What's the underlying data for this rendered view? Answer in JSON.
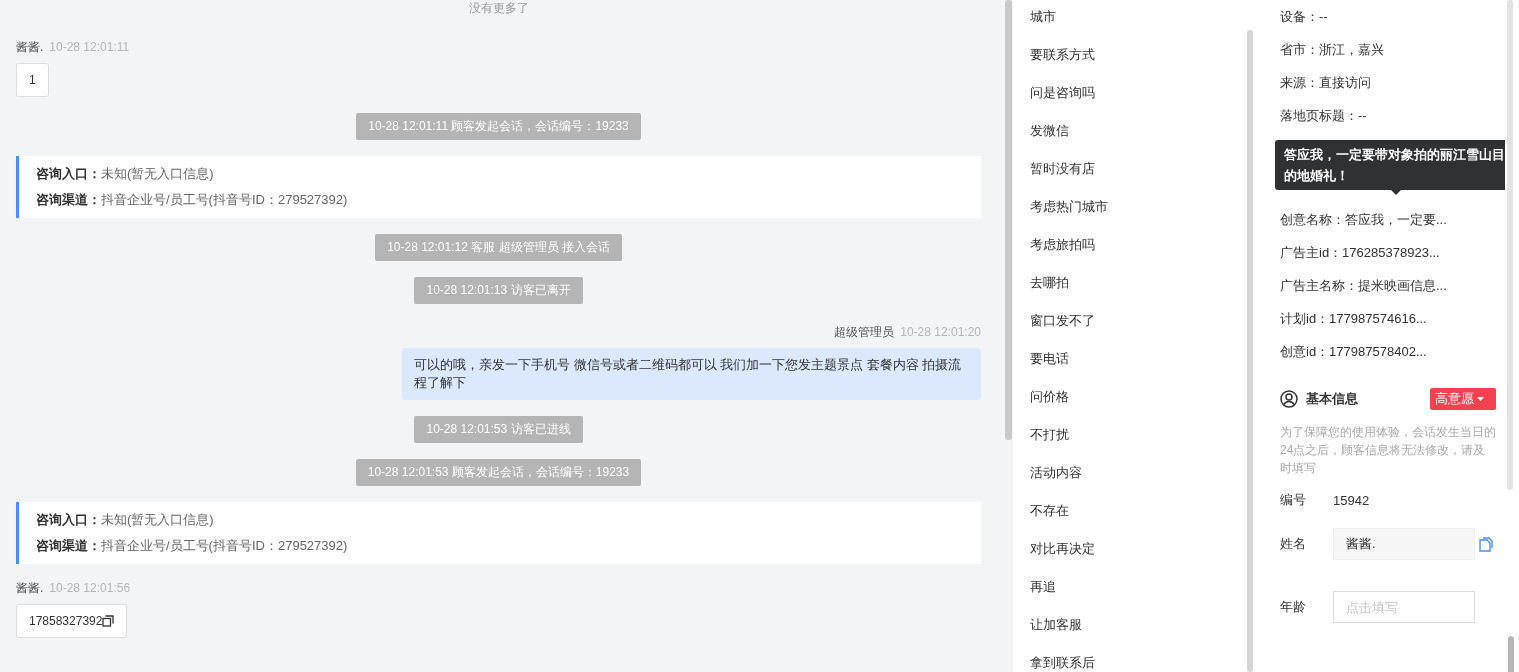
{
  "chat": {
    "no_more": "没有更多了",
    "messages": [
      {
        "kind": "visitor",
        "sender": "酱酱.",
        "time": "10-28 12:01:11",
        "text": "1",
        "copyable": false
      },
      {
        "kind": "system",
        "text": "10-28 12:01:11 顾客发起会话，会话编号：19233"
      },
      {
        "kind": "entry",
        "lines": [
          {
            "label": "咨询入口：",
            "value": "未知(暂无入口信息)"
          },
          {
            "label": "咨询渠道：",
            "value": "抖音企业号/员工号(抖音号ID：279527392)"
          }
        ]
      },
      {
        "kind": "system",
        "text": "10-28 12:01:12 客服 超级管理员 接入会话"
      },
      {
        "kind": "system",
        "text": "10-28 12:01:13 访客已离开"
      },
      {
        "kind": "agent",
        "sender": "超级管理员",
        "time": "10-28 12:01:20",
        "text": "可以的哦，亲发一下手机号 微信号或者二维码都可以 我们加一下您发主题景点 套餐内容 拍摄流程了解下"
      },
      {
        "kind": "system",
        "text": "10-28 12:01:53 访客已进线"
      },
      {
        "kind": "system",
        "text": "10-28 12:01:53 顾客发起会话，会话编号：19233"
      },
      {
        "kind": "entry",
        "lines": [
          {
            "label": "咨询入口：",
            "value": "未知(暂无入口信息)"
          },
          {
            "label": "咨询渠道：",
            "value": "抖音企业号/员工号(抖音号ID：279527392)"
          }
        ]
      },
      {
        "kind": "visitor",
        "sender": "酱酱.",
        "time": "10-28 12:01:56",
        "text": "17858327392",
        "copyable": true
      }
    ]
  },
  "quick_replies": [
    "城市",
    "要联系方式",
    "问是咨询吗",
    "发微信",
    "暂时没有店",
    "考虑热门城市",
    "考虑旅拍吗",
    "去哪拍",
    "窗口发不了",
    "要电话",
    "问价格",
    "不打扰",
    "活动内容",
    "不存在",
    "对比再决定",
    "再追",
    "让加客服",
    "拿到联系后"
  ],
  "info_panel": {
    "fields": [
      "设备：--",
      "省市：浙江，嘉兴",
      "来源：直接访问",
      "落地页标题：--",
      "创意名称：答应我，一定要...",
      "广告主id：176285378923...",
      "广告主名称：提米映画信息...",
      "计划id：177987574616...",
      "创意id：177987578402..."
    ],
    "tooltip": "答应我，一定要带对象拍的丽江雪山目的地婚礼！",
    "basic": {
      "title": "基本信息",
      "intent": "高意愿",
      "notice": "为了保障您的使用体验，会话发生当日的24点之后，顾客信息将无法修改，请及时填写",
      "number": {
        "label": "编号",
        "value": "15942"
      },
      "name": {
        "label": "姓名",
        "value": "酱酱."
      },
      "age": {
        "label": "年龄",
        "placeholder": "点击填写"
      }
    }
  }
}
